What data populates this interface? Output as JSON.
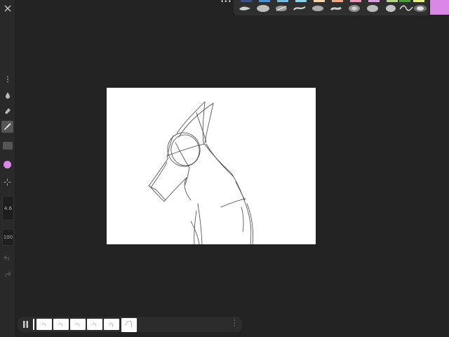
{
  "sidebar": {
    "brush_size": "4.6",
    "opacity": "100",
    "current_color": "#d986e6"
  },
  "palette": {
    "swatch_colors": [
      "#3b4f8a",
      "#4a8fd6",
      "#78b9e0",
      "#8fd0e6",
      "#f3d5a8",
      "#f0a882",
      "#e79bb8",
      "#d99fe0",
      "#b4d48a",
      "#4c9a3a",
      "#e6f07a"
    ],
    "brush_icons": [
      "smudge-brush-icon",
      "soft-brush-icon",
      "scatter-brush-icon",
      "ink-brush-icon",
      "pencil-brush-icon",
      "flat-brush-icon",
      "airbrush-icon",
      "round-brush-icon",
      "blob-brush-icon",
      "wave-brush-icon",
      "glow-brush-icon"
    ]
  },
  "timeline": {
    "frame_count": 6,
    "active_frame": 6
  }
}
